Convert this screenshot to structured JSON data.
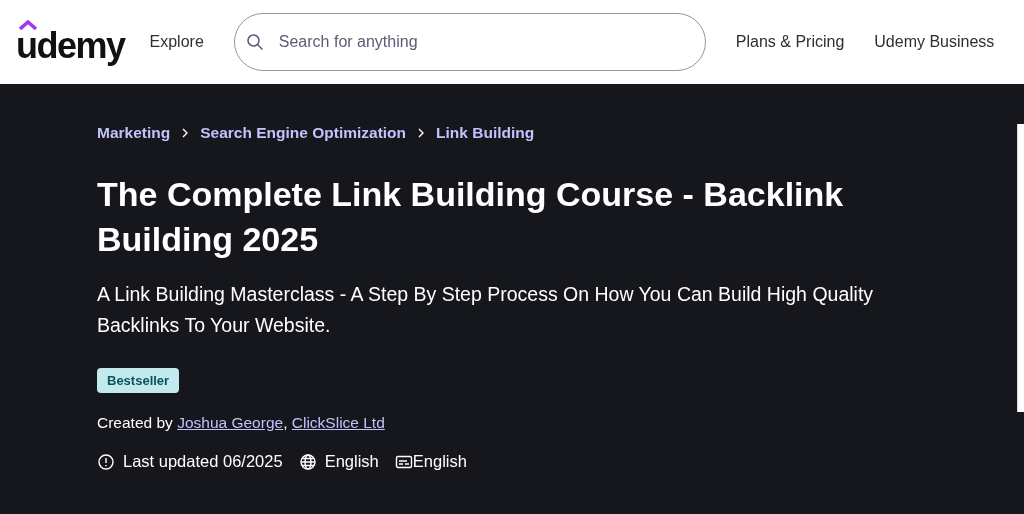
{
  "header": {
    "logo": "udemy",
    "nav_left": "Explore",
    "search": {
      "placeholder": "Search for anything"
    },
    "nav_right": [
      "Plans & Pricing",
      "Udemy Business"
    ]
  },
  "breadcrumbs": [
    "Marketing",
    "Search Engine Optimization",
    "Link Building"
  ],
  "course": {
    "title": "The Complete Link Building Course - Backlink Building 2025",
    "subtitle": "A Link Building Masterclass - A Step By Step Process On How You Can Build High Quality Backlinks To Your Website.",
    "badge": "Bestseller",
    "created_by_label": "Created by",
    "authors": [
      "Joshua George",
      "ClickSlice Ltd"
    ],
    "author_separator": ",",
    "last_updated": "Last updated 06/2025",
    "language": "English",
    "captions": "English"
  }
}
